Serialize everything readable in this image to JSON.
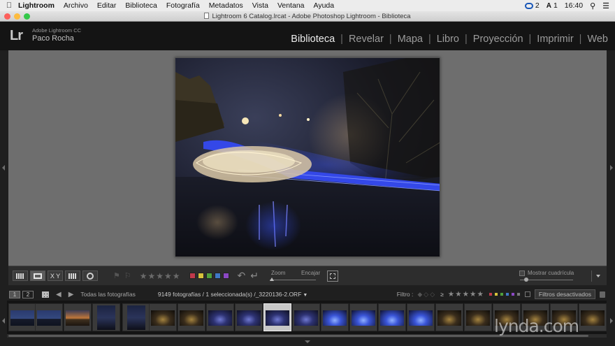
{
  "menubar": {
    "items": [
      "Lightroom",
      "Archivo",
      "Editar",
      "Biblioteca",
      "Fotografía",
      "Metadatos",
      "Vista",
      "Ventana",
      "Ayuda"
    ],
    "cc_count": "2",
    "adobe_count": "1",
    "time": "16:40",
    "icons": [
      "apple-icon",
      "creative-cloud-icon",
      "adobe-icon",
      "search-icon",
      "menu-list-icon"
    ]
  },
  "window": {
    "title": "Lightroom 6 Catalog.lrcat - Adobe Photoshop Lightroom - Biblioteca"
  },
  "identity": {
    "logo": "Lr",
    "product": "Adobe Lightroom CC",
    "user": "Paco Rocha"
  },
  "modules": [
    "Biblioteca",
    "Revelar",
    "Mapa",
    "Libro",
    "Proyección",
    "Imprimir",
    "Web"
  ],
  "active_module": "Biblioteca",
  "toolbar": {
    "zoom_label": "Zoom",
    "fit_label": "Encajar",
    "view_modes": [
      "grid",
      "loupe",
      "compare",
      "survey",
      "people"
    ],
    "compare_label": "X Y",
    "show_grid_label": "Mostrar cuadrícula",
    "label_colors": [
      "#c0394b",
      "#d6c23b",
      "#4fa03c",
      "#3f78c6",
      "#8b48c4"
    ]
  },
  "filmstrip_header": {
    "screen_1": "1",
    "screen_2": "2",
    "source": "Todas las fotografías",
    "count_text": "9149 fotografías / 1 seleccionada(s) /_3220136-2.ORF",
    "filter_label": "Filtro :",
    "filter_ge": "≥",
    "filter_button": "Filtros desactivados"
  },
  "filmstrip": {
    "thumbs": [
      {
        "kind": "landscape",
        "tone": "dusk-blue"
      },
      {
        "kind": "landscape",
        "tone": "dusk-blue"
      },
      {
        "kind": "landscape",
        "tone": "sunset"
      },
      {
        "kind": "portrait",
        "tone": "night-city"
      },
      {
        "kind": "portrait",
        "tone": "night-city"
      },
      {
        "kind": "landscape",
        "tone": "night-warm"
      },
      {
        "kind": "landscape",
        "tone": "night-warm"
      },
      {
        "kind": "landscape",
        "tone": "bridge-blue"
      },
      {
        "kind": "landscape",
        "tone": "bridge-blue"
      },
      {
        "kind": "landscape",
        "tone": "bridge-blue",
        "selected": true
      },
      {
        "kind": "landscape",
        "tone": "bridge-blue"
      },
      {
        "kind": "landscape",
        "tone": "bridge-bright"
      },
      {
        "kind": "landscape",
        "tone": "bridge-bright"
      },
      {
        "kind": "landscape",
        "tone": "bridge-bright"
      },
      {
        "kind": "landscape",
        "tone": "bridge-bright"
      },
      {
        "kind": "landscape",
        "tone": "night-warm"
      },
      {
        "kind": "landscape",
        "tone": "night-warm"
      },
      {
        "kind": "landscape",
        "tone": "night-warm"
      },
      {
        "kind": "landscape",
        "tone": "night-warm"
      },
      {
        "kind": "landscape",
        "tone": "night-warm"
      },
      {
        "kind": "landscape",
        "tone": "night-warm"
      }
    ]
  },
  "watermark": "lynda.com"
}
